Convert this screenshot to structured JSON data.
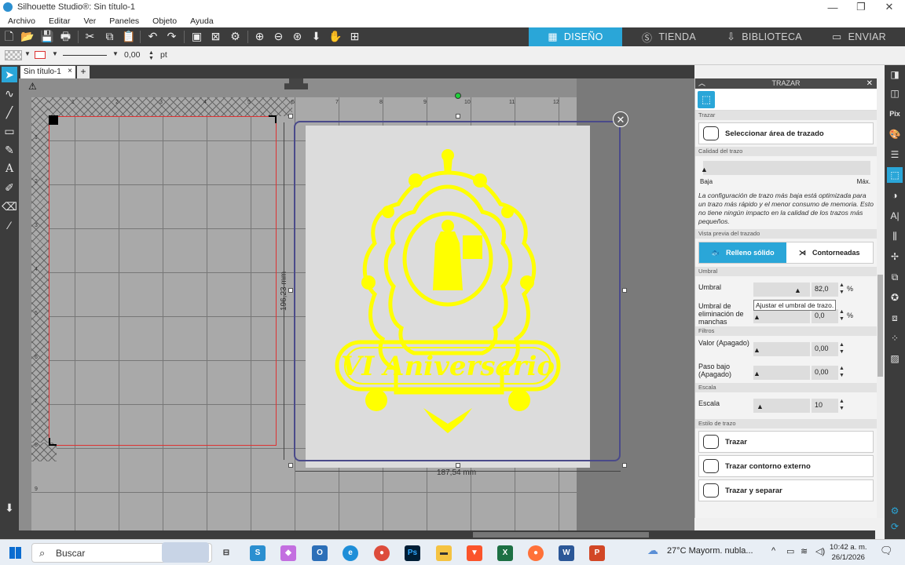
{
  "window": {
    "title": "Silhouette Studio®: Sin título-1",
    "minimize": "—",
    "maximize": "❐",
    "close": "✕"
  },
  "menu": [
    "Archivo",
    "Editar",
    "Ver",
    "Paneles",
    "Objeto",
    "Ayuda"
  ],
  "modes": {
    "design": "DISEÑO",
    "store": "TIENDA",
    "library": "BIBLIOTECA",
    "send": "ENVIAR"
  },
  "linebar": {
    "width_value": "0,00",
    "unit": "pt"
  },
  "doc_tab": {
    "name": "Sin título-1",
    "close": "×",
    "add": "+"
  },
  "ruler_top": [
    "1",
    "2",
    "3",
    "4",
    "5",
    "6",
    "7",
    "8",
    "9",
    "10",
    "11",
    "12"
  ],
  "ruler_left": [
    "1",
    "2",
    "3",
    "4",
    "5",
    "6",
    "7",
    "8",
    "9"
  ],
  "dimensions": {
    "height": "196,23 mm",
    "width": "187,54 mm"
  },
  "artwork": {
    "banner_text": "VI Aniversario",
    "color": "#ffff00"
  },
  "panel": {
    "title": "TRAZAR",
    "sections": {
      "trace": "Trazar",
      "quality": "Calidad del trazo",
      "preview": "Vista previa del trazado",
      "threshold": "Umbral",
      "filters": "Filtros",
      "scale": "Escala",
      "style": "Estilo de trazo"
    },
    "select_area": "Seleccionar área de trazado",
    "quality_low": "Baja",
    "quality_max": "Máx.",
    "description": "La configuración de trazo más baja está optimizada para un trazo más rápido y el menor consumo de memoria. Esto no tiene ningún impacto en la calidad de los trazos más pequeños.",
    "preview_solid": "Relleno sólido",
    "preview_outline": "Contorneadas",
    "threshold_label": "Umbral",
    "threshold_value": "82,0",
    "threshold_unit": "%",
    "tooltip": "Ajustar el umbral de trazo.",
    "speckle_label": "Umbral de eliminación de manchas",
    "speckle_value": "0,0",
    "speckle_unit": "%",
    "value_label": "Valor (Apagado)",
    "value_value": "0,00",
    "lowpass_label": "Paso bajo (Apagado)",
    "lowpass_value": "0,00",
    "scale_label": "Escala",
    "scale_value": "10",
    "style_trace": "Trazar",
    "style_outer": "Trazar contorno externo",
    "style_separate": "Trazar y separar"
  },
  "taskbar": {
    "search": "Buscar",
    "weather": "27°C  Mayorm. nubla...",
    "time": "10:42 a. m.",
    "date": "26/1/2026"
  },
  "colors": {
    "accent": "#2aa6d8",
    "toolbar": "#3c3c3c"
  }
}
